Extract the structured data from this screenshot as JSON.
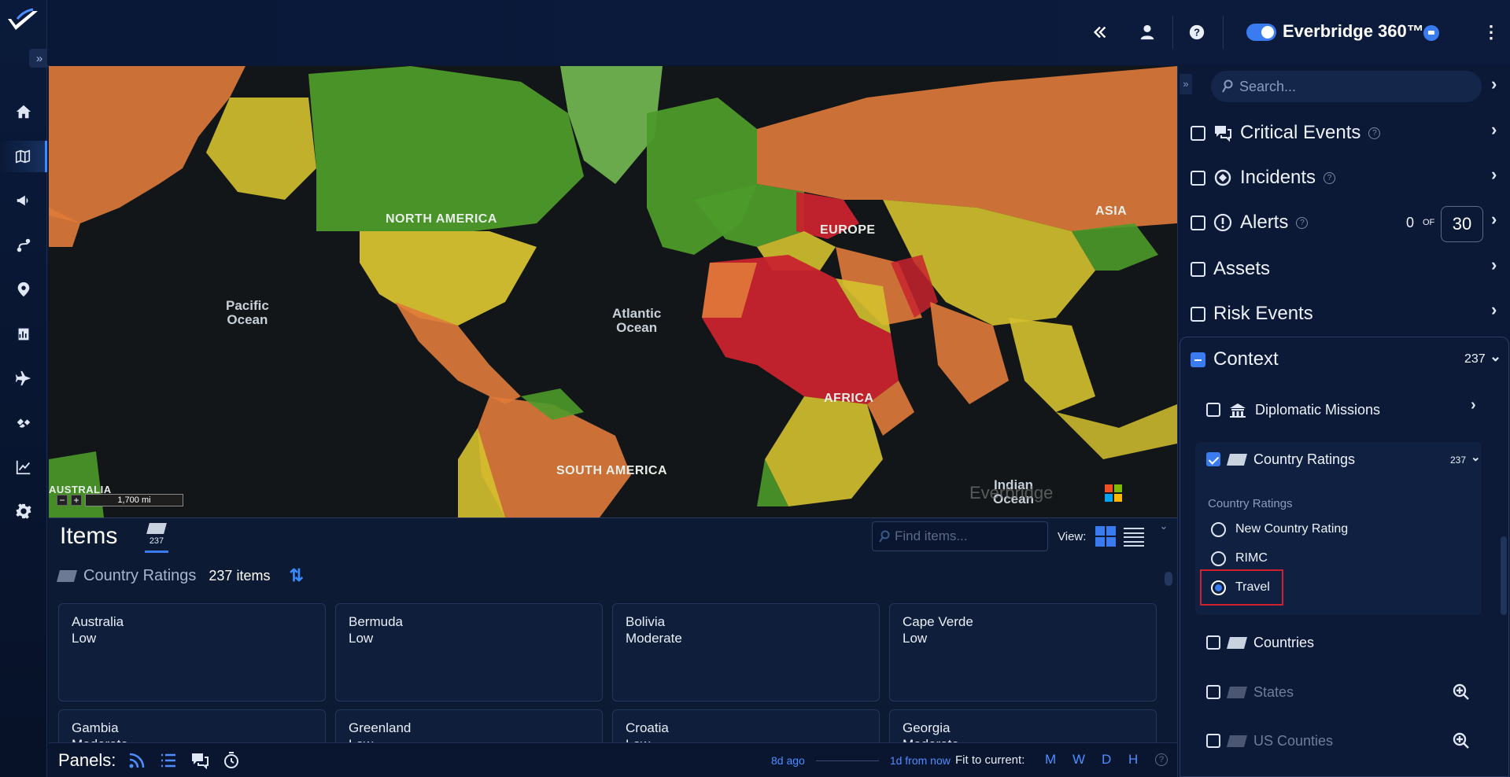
{
  "topbar": {
    "brand": "Everbridge 360™",
    "icons": [
      "double-chevron-left-icon",
      "user-icon",
      "help-icon",
      "toggle",
      "chat-badge-icon",
      "kebab-menu-icon"
    ]
  },
  "rail": {
    "items": [
      "home-icon",
      "map-icon",
      "megaphone-icon",
      "route-icon",
      "location-pin-icon",
      "report-icon",
      "plane-icon",
      "satellite-icon",
      "line-chart-icon",
      "gear-icon"
    ],
    "active": "map-icon"
  },
  "map": {
    "labels": {
      "north_america": "NORTH AMERICA",
      "europe": "EUROPE",
      "asia": "ASIA",
      "africa": "AFRICA",
      "south_america": "SOUTH AMERICA",
      "australia": "AUSTRALIA",
      "pacific_line1": "Pacific",
      "pacific_line2": "Ocean",
      "atlantic_line1": "Atlantic",
      "atlantic_line2": "Ocean",
      "indian_line1": "Indian",
      "indian_line2": "Ocean"
    },
    "scale": "1,700 mi",
    "zoom_out": "−",
    "zoom_in": "+",
    "watermark": "Everbridge",
    "rating_colors": {
      "low": "#4c9a2a",
      "moderate": "#d5c12f",
      "high": "#e07a3a",
      "extreme": "#c8232d"
    }
  },
  "items": {
    "title": "Items",
    "tab_count": "237",
    "find_placeholder": "Find items...",
    "view_label": "View:",
    "group": {
      "name": "Country Ratings",
      "count": "237 items"
    },
    "cards": [
      {
        "country": "Australia",
        "rating": "Low"
      },
      {
        "country": "Bermuda",
        "rating": "Low"
      },
      {
        "country": "Bolivia",
        "rating": "Moderate"
      },
      {
        "country": "Cape Verde",
        "rating": "Low"
      },
      {
        "country": "Gambia",
        "rating": "Moderate"
      },
      {
        "country": "Greenland",
        "rating": "Low"
      },
      {
        "country": "Croatia",
        "rating": "Low"
      },
      {
        "country": "Georgia",
        "rating": "Moderate"
      }
    ]
  },
  "panels": {
    "label": "Panels:",
    "timeline_start": "8d ago",
    "timeline_end": "1d from now",
    "fit_label": "Fit to current:",
    "fit_options": [
      "M",
      "W",
      "D",
      "H"
    ],
    "help": "?"
  },
  "rightpanel": {
    "search_placeholder": "Search...",
    "layers": {
      "critical_events": "Critical Events",
      "incidents": "Incidents",
      "alerts": "Alerts",
      "alerts_count": "0",
      "alerts_of": "OF",
      "alerts_max": "30",
      "assets": "Assets",
      "risk_events": "Risk Events",
      "context": "Context",
      "context_count": "237"
    },
    "context_items": {
      "diplomatic": "Diplomatic Missions",
      "country_ratings": "Country Ratings",
      "country_ratings_count": "237",
      "sub_label": "Country Ratings",
      "options": [
        "New Country Rating",
        "RIMC",
        "Travel"
      ],
      "selected_option": "Travel",
      "countries": "Countries",
      "states": "States",
      "us_counties": "US Counties"
    }
  }
}
